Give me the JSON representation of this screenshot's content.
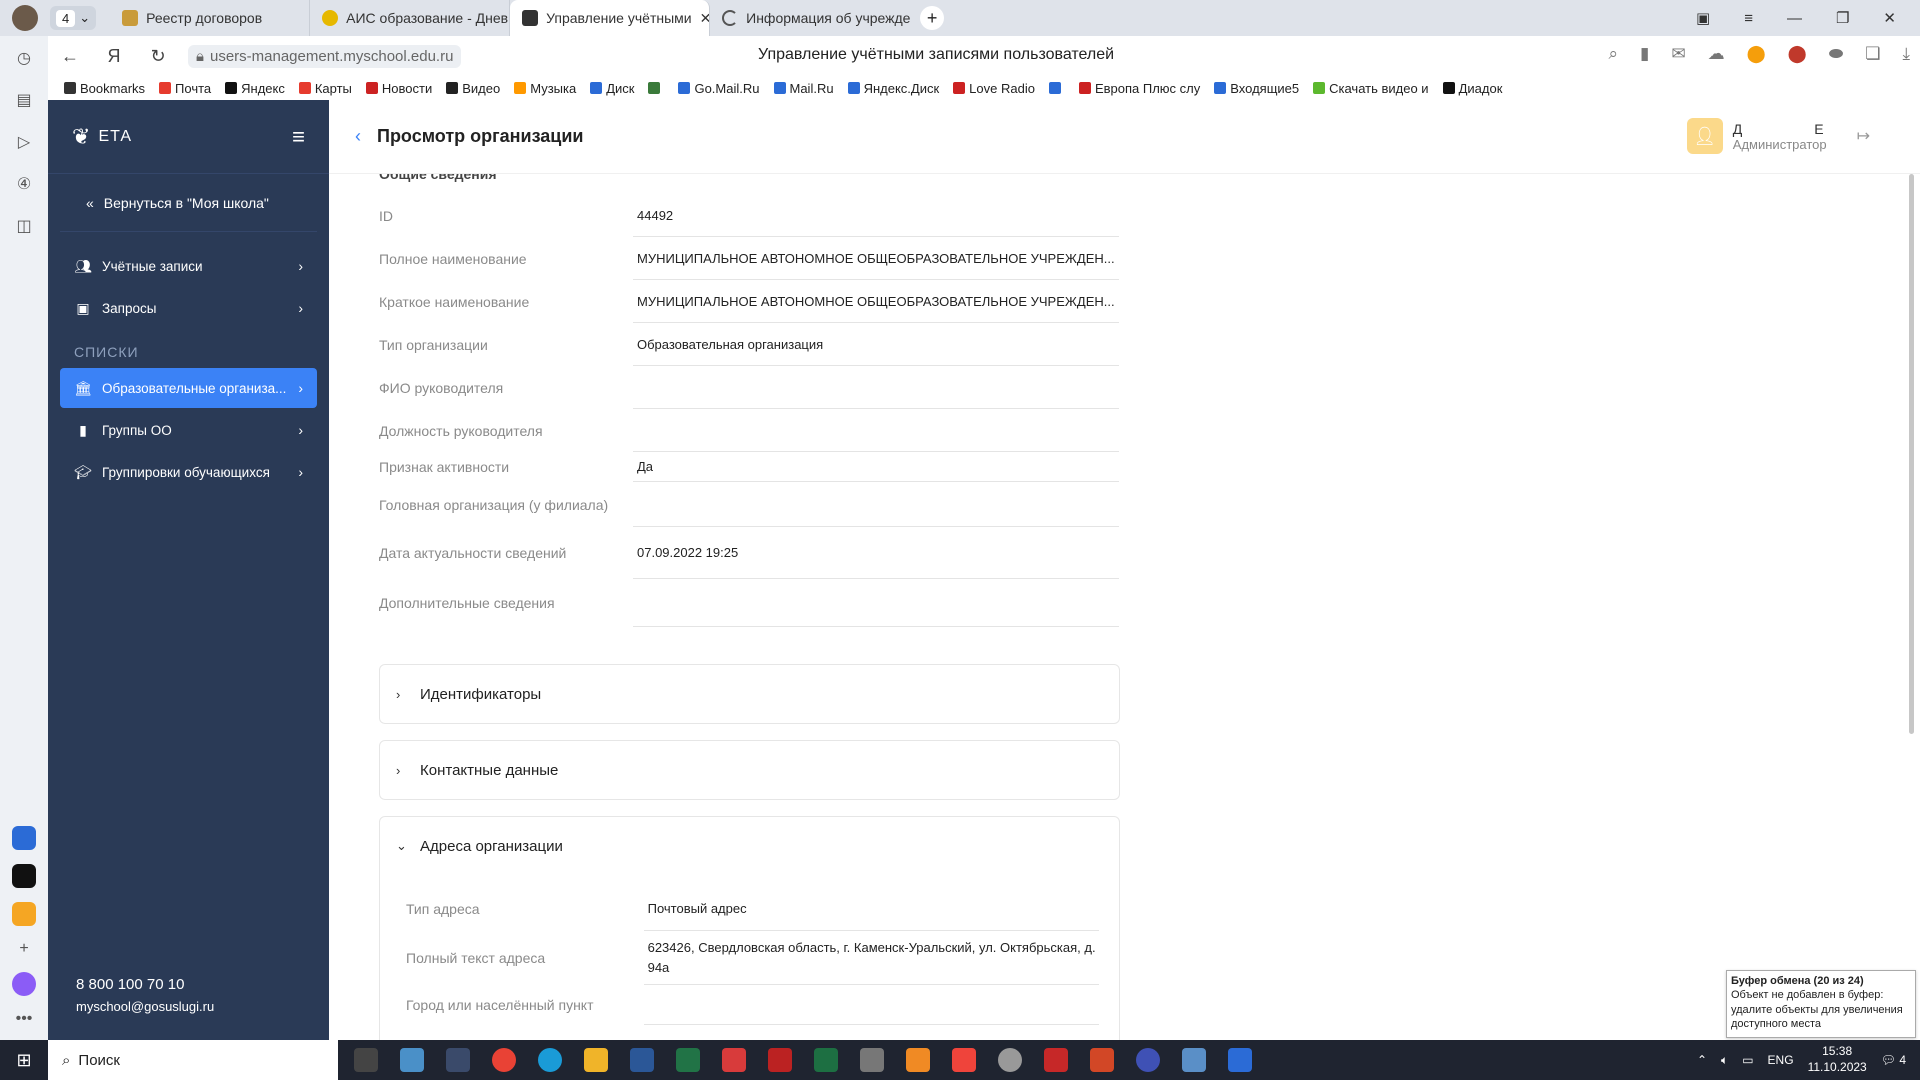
{
  "browser": {
    "tab_count": "4",
    "tabs": [
      {
        "title": "Реестр договоров",
        "color": "#c99b3a"
      },
      {
        "title": "АИС образование - Днев",
        "color": "#e6b800"
      },
      {
        "title": "Управление учётными",
        "color": "#333333"
      },
      {
        "title": "Информация об учрежде",
        "color": "#555555"
      }
    ],
    "active_tab_close": "✕",
    "url": "users-management.myschool.edu.ru",
    "page_title": "Управление учётными записями пользователей",
    "bookmarks": [
      {
        "label": "Bookmarks",
        "color": "#333333"
      },
      {
        "label": "Почта",
        "color": "#e63b2e"
      },
      {
        "label": "Яндекс",
        "color": "#111111"
      },
      {
        "label": "Карты",
        "color": "#e63b2e"
      },
      {
        "label": "Новости",
        "color": "#c22"
      },
      {
        "label": "Видео",
        "color": "#222"
      },
      {
        "label": "Музыка",
        "color": "#ff9900"
      },
      {
        "label": "Диск",
        "color": "#2b6bd6"
      },
      {
        "label": "",
        "color": "#3a7a3a"
      },
      {
        "label": "Go.Mail.Ru",
        "color": "#2b6bd6"
      },
      {
        "label": "Mail.Ru",
        "color": "#2b6bd6"
      },
      {
        "label": "Яндекс.Диск",
        "color": "#2b6bd6"
      },
      {
        "label": "Love Radio",
        "color": "#c22"
      },
      {
        "label": "",
        "color": "#2b6bd6"
      },
      {
        "label": "Европа Плюс слу",
        "color": "#c22"
      },
      {
        "label": "Входящие5",
        "color": "#2b6bd6"
      },
      {
        "label": "Скачать видео и",
        "color": "#5cb82e"
      },
      {
        "label": "Диадок",
        "color": "#111"
      }
    ]
  },
  "sidebar": {
    "logo_text": "ЕТА",
    "back_label": "Вернуться в \"Моя школа\"",
    "items": [
      {
        "label": "Учётные записи",
        "icon": "users-icon"
      },
      {
        "label": "Запросы",
        "icon": "inbox-icon"
      }
    ],
    "section_label": "СПИСКИ",
    "list_items": [
      {
        "label": "Образовательные организа...",
        "icon": "building-icon",
        "active": true
      },
      {
        "label": "Группы ОО",
        "icon": "bookmark-icon",
        "active": false
      },
      {
        "label": "Группировки обучающихся",
        "icon": "graduation-icon",
        "active": false
      }
    ],
    "phone": "8 800 100 70 10",
    "email": "myschool@gosuslugi.ru"
  },
  "header": {
    "title": "Просмотр организации",
    "user_first": "Д",
    "user_last": "Е",
    "user_role": "Администратор"
  },
  "general": {
    "section_title": "Общие сведения",
    "fields": [
      {
        "label": "ID",
        "value": "44492"
      },
      {
        "label": "Полное наименование",
        "value": "МУНИЦИПАЛЬНОЕ АВТОНОМНОЕ ОБЩЕОБРАЗОВАТЕЛЬНОЕ УЧРЕЖДЕН..."
      },
      {
        "label": "Краткое наименование",
        "value": "МУНИЦИПАЛЬНОЕ АВТОНОМНОЕ ОБЩЕОБРАЗОВАТЕЛЬНОЕ УЧРЕЖДЕН..."
      },
      {
        "label": "Тип организации",
        "value": "Образовательная организация"
      },
      {
        "label": "ФИО руководителя",
        "value": ""
      },
      {
        "label": "Должность руководителя",
        "value": ""
      },
      {
        "label": "Признак активности",
        "value": "Да"
      },
      {
        "label": "Головная организация (у филиала)",
        "value": ""
      },
      {
        "label": "Дата актуальности сведений",
        "value": "07.09.2022 19:25"
      },
      {
        "label": "Дополнительные сведения",
        "value": ""
      }
    ]
  },
  "accordions": {
    "identifiers": "Идентификаторы",
    "contacts": "Контактные данные",
    "addresses": "Адреса организации"
  },
  "addresses": {
    "fields": [
      {
        "label": "Тип адреса",
        "value": "Почтовый адрес"
      },
      {
        "label": "Полный текст адреса",
        "value": "623426, Свердловская область, г. Каменск-Уральский, ул. Октябрьская, д. 94а"
      },
      {
        "label": "Город или населённый пункт",
        "value": ""
      }
    ]
  },
  "clipboard": {
    "title": "Буфер обмена (20 из 24)",
    "text": "Объект не добавлен в буфер: удалите объекты для увеличения доступного места"
  },
  "taskbar": {
    "search_label": "Поиск",
    "lang": "ENG",
    "time": "15:38",
    "date": "11.10.2023",
    "notif_count": "4"
  },
  "colors": {
    "sidebar_bg": "#2a3a56",
    "accent": "#3b82f6"
  }
}
